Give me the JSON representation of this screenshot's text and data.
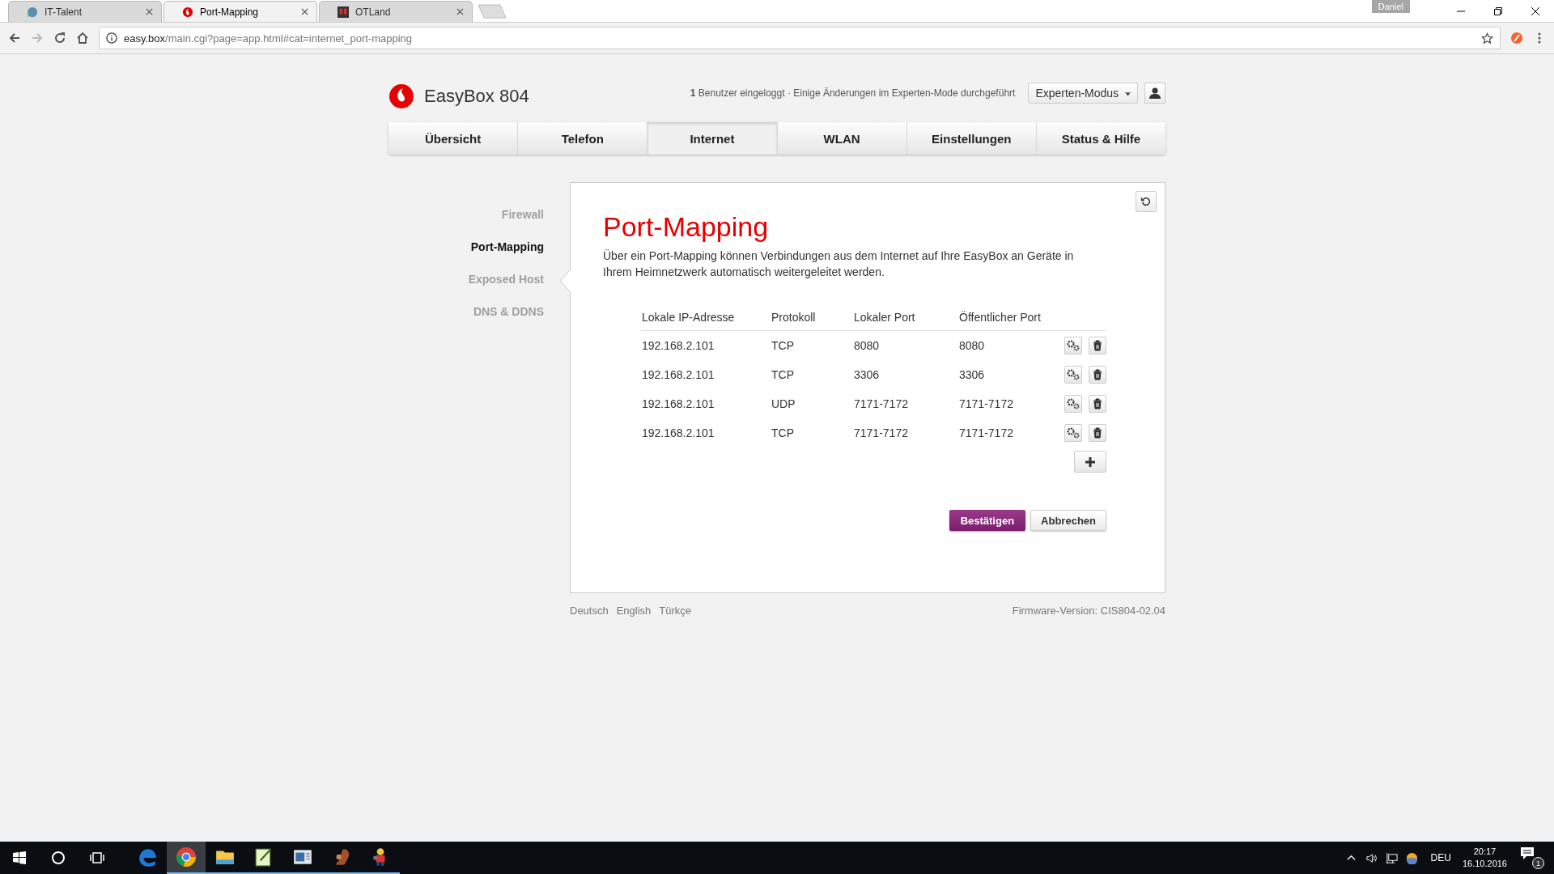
{
  "browser": {
    "tabs": [
      {
        "kind": "chat",
        "label": "IT-Talent",
        "selected": false
      },
      {
        "kind": "drop",
        "label": "Port-Mapping",
        "selected": true
      },
      {
        "kind": "badge",
        "label": "OTLand",
        "selected": false
      }
    ],
    "profile": "Daniel",
    "url_host": "easy.box",
    "url_path": "/main.cgi?page=app.html#cat=internet_port-mapping"
  },
  "header": {
    "brand": "EasyBox 804",
    "status_count": "1",
    "status_text": "Benutzer eingeloggt · Einige Änderungen im Experten-Mode durchgeführt",
    "mode": "Experten-Modus"
  },
  "nav": [
    {
      "label": "Übersicht",
      "selected": false
    },
    {
      "label": "Telefon",
      "selected": false
    },
    {
      "label": "Internet",
      "selected": true
    },
    {
      "label": "WLAN",
      "selected": false
    },
    {
      "label": "Einstellungen",
      "selected": false
    },
    {
      "label": "Status & Hilfe",
      "selected": false
    }
  ],
  "sidebar": [
    {
      "label": "Firewall",
      "selected": false
    },
    {
      "label": "Port-Mapping",
      "selected": true
    },
    {
      "label": "Exposed Host",
      "selected": false
    },
    {
      "label": "DNS & DDNS",
      "selected": false
    }
  ],
  "page": {
    "title": "Port-Mapping",
    "description": "Über ein Port-Mapping können Verbindungen aus dem Internet auf Ihre EasyBox an Geräte in Ihrem Heimnetzwerk automatisch weitergeleitet werden."
  },
  "table": {
    "columns": [
      "Lokale IP-Adresse",
      "Protokoll",
      "Lokaler Port",
      "Öffentlicher Port"
    ],
    "rows": [
      [
        "192.168.2.101",
        "TCP",
        "8080",
        "8080"
      ],
      [
        "192.168.2.101",
        "TCP",
        "3306",
        "3306"
      ],
      [
        "192.168.2.101",
        "UDP",
        "7171-7172",
        "7171-7172"
      ],
      [
        "192.168.2.101",
        "TCP",
        "7171-7172",
        "7171-7172"
      ]
    ]
  },
  "buttons": {
    "confirm": "Bestätigen",
    "cancel": "Abbrechen"
  },
  "footer": {
    "languages": [
      "Deutsch",
      "English",
      "Türkçe"
    ],
    "firmware": "Firmware-Version: CIS804-02.04"
  },
  "taskbar": {
    "apps": [
      {
        "kind": "edge",
        "selected": false,
        "running": false
      },
      {
        "kind": "chrome",
        "selected": true,
        "running": true
      },
      {
        "kind": "folder",
        "selected": false,
        "running": true
      },
      {
        "kind": "notepad",
        "selected": false,
        "running": true
      },
      {
        "kind": "window",
        "selected": false,
        "running": true
      },
      {
        "kind": "squirrel",
        "selected": false,
        "running": true
      },
      {
        "kind": "figure",
        "selected": false,
        "running": true
      }
    ],
    "language": "DEU",
    "time": "20:17",
    "date": "16.10.2016",
    "notifications": "1"
  }
}
